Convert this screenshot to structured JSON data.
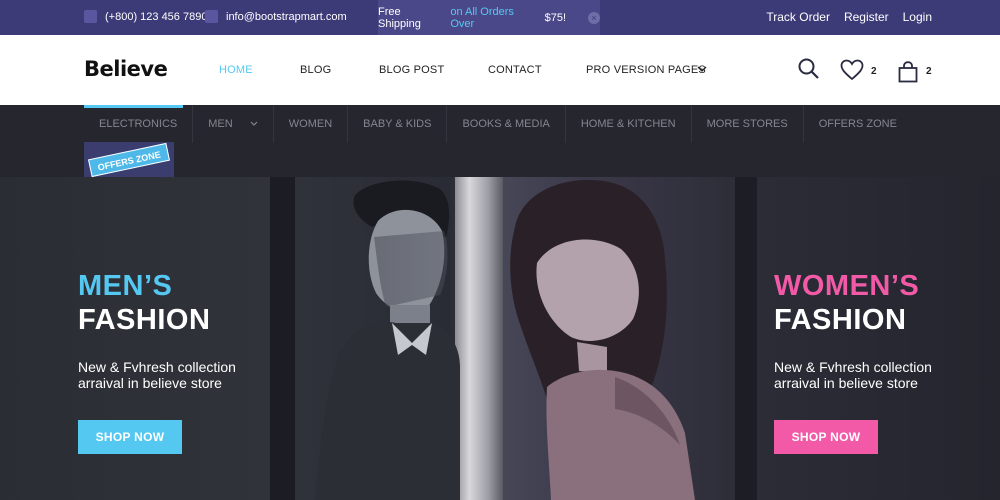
{
  "topbar": {
    "phone": "(+800) 123 456 7890",
    "email": "info@bootstrapmart.com",
    "shipping_prefix": "Free Shipping",
    "shipping_highlight": "on All Orders Over",
    "shipping_amount": "$75!",
    "close_glyph": "×",
    "links": {
      "track": "Track Order",
      "register": "Register",
      "login": "Login"
    }
  },
  "header": {
    "logo": "Believe",
    "nav": {
      "home": "HOME",
      "blog": "BLOG",
      "blog_post": "BLOG POST",
      "contact": "CONTACT",
      "pro": "PRO VERSION PAGES"
    },
    "wishlist_count": "2",
    "cart_count": "2"
  },
  "categories": {
    "electronics": "ELECTRONICS",
    "men": "MEN",
    "women": "WOMEN",
    "baby": "BABY & KIDS",
    "books": "BOOKS & MEDIA",
    "home": "HOME & KITCHEN",
    "more": "MORE STORES",
    "offers": "OFFERS ZONE",
    "offers_badge": "OFFERS ZONE"
  },
  "hero": {
    "men": {
      "accent": "MEN’S",
      "title": "FASHION",
      "desc1": "New & Fvhresh collection",
      "desc2": "arraival in believe store",
      "button": "SHOP NOW"
    },
    "women": {
      "accent": "WOMEN’S",
      "title": "FASHION",
      "desc1": "New & Fvhresh collection",
      "desc2": "arraival in believe store",
      "button": "SHOP NOW"
    }
  },
  "colors": {
    "topbar": "#3d3a78",
    "accent_blue": "#55c8f2",
    "accent_pink": "#f25aa8"
  }
}
